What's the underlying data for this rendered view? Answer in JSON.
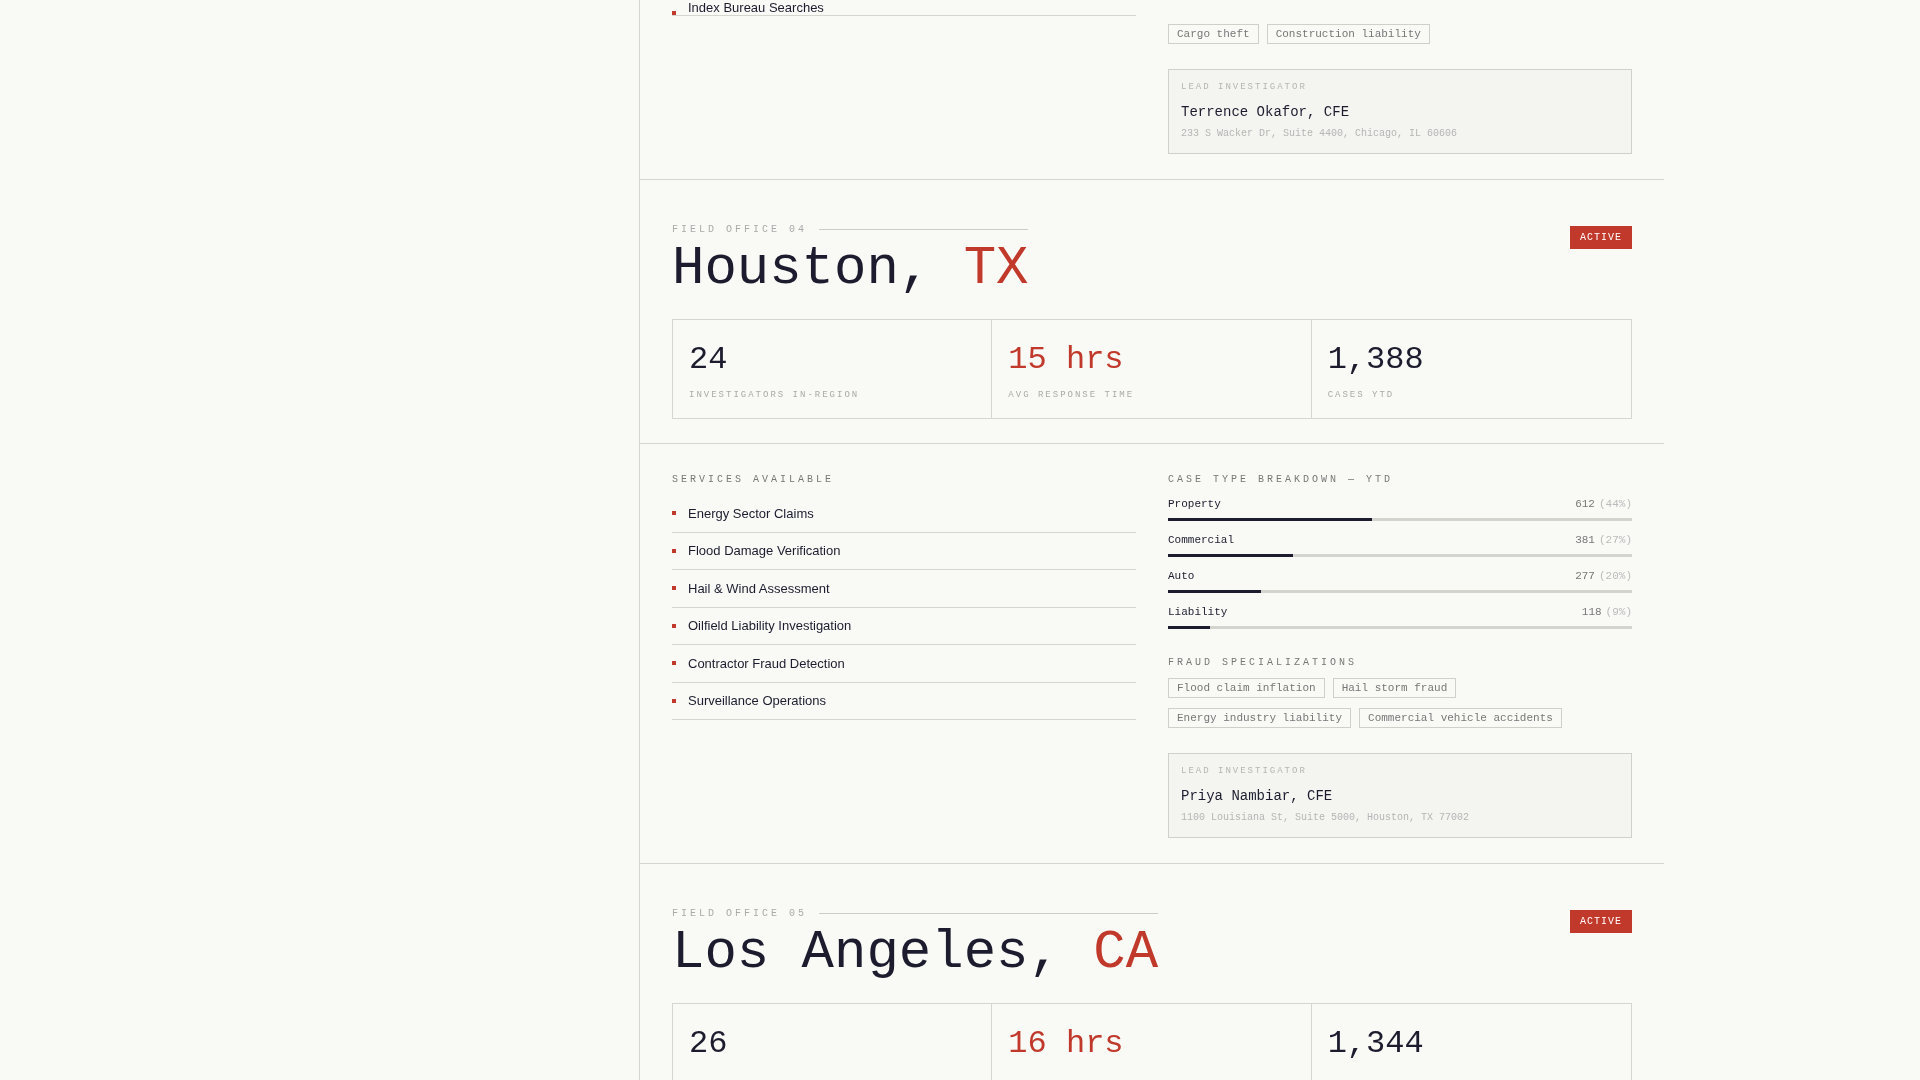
{
  "previous_office": {
    "services": [
      "Index Bureau Searches"
    ],
    "fraud_specializations": [
      "Cargo theft",
      "Construction liability"
    ],
    "lead_investigator": {
      "label": "LEAD INVESTIGATOR",
      "name": "Terrence Okafor, CFE",
      "address": "233 S Wacker Dr, Suite 4400, Chicago, IL 60606"
    }
  },
  "offices": [
    {
      "label": "FIELD OFFICE 04",
      "city": "Houston,",
      "state": "TX",
      "status": "ACTIVE",
      "stats": [
        {
          "value": "24",
          "label": "INVESTIGATORS IN-REGION",
          "accent": false
        },
        {
          "value": "15 hrs",
          "label": "AVG RESPONSE TIME",
          "accent": true
        },
        {
          "value": "1,388",
          "label": "CASES YTD",
          "accent": false
        }
      ],
      "services_heading": "SERVICES AVAILABLE",
      "services": [
        "Energy Sector Claims",
        "Flood Damage Verification",
        "Hail & Wind Assessment",
        "Oilfield Liability Investigation",
        "Contractor Fraud Detection",
        "Surveillance Operations"
      ],
      "breakdown_heading": "CASE TYPE BREAKDOWN — YTD",
      "breakdown": [
        {
          "name": "Property",
          "count": "612",
          "percent": "(44%)",
          "level": 0.44
        },
        {
          "name": "Commercial",
          "count": "381",
          "percent": "(27%)",
          "level": 0.27
        },
        {
          "name": "Auto",
          "count": "277",
          "percent": "(20%)",
          "level": 0.2
        },
        {
          "name": "Liability",
          "count": "118",
          "percent": "(9%)",
          "level": 0.09
        }
      ],
      "fraud_heading": "FRAUD SPECIALIZATIONS",
      "fraud_specializations": [
        "Flood claim inflation",
        "Hail storm fraud",
        "Energy industry liability",
        "Commercial vehicle accidents"
      ],
      "lead_investigator": {
        "label": "LEAD INVESTIGATOR",
        "name": "Priya Nambiar, CFE",
        "address": "1100 Louisiana St, Suite 5000, Houston, TX 77002"
      }
    },
    {
      "label": "FIELD OFFICE 05",
      "city": "Los Angeles,",
      "state": "CA",
      "status": "ACTIVE",
      "stats": [
        {
          "value": "26",
          "accent": false
        },
        {
          "value": "16 hrs",
          "accent": true
        },
        {
          "value": "1,344",
          "accent": false
        }
      ]
    }
  ]
}
